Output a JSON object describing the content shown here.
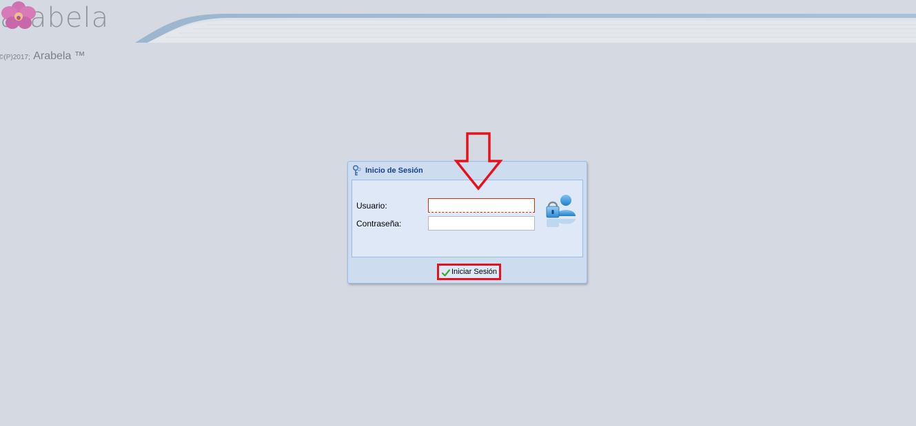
{
  "header": {
    "logo_text": "arabela",
    "copyright_prefix": "©(P)2017;",
    "copyright_brand": "Arabela ™"
  },
  "login": {
    "title": "Inicio de Sesión",
    "username_label": "Usuario:",
    "username_value": "",
    "password_label": "Contraseña:",
    "password_value": "",
    "submit_label": "Iniciar Sesión"
  },
  "icons": {
    "window": "key-icon",
    "side": "user-lock-icon",
    "submit": "checkmark-icon",
    "logo": "orchid-flower-icon",
    "annotation": "down-arrow-annotation"
  },
  "colors": {
    "background": "#d5dae2",
    "annotation_red": "#e8101b",
    "window_title": "#15428b"
  }
}
